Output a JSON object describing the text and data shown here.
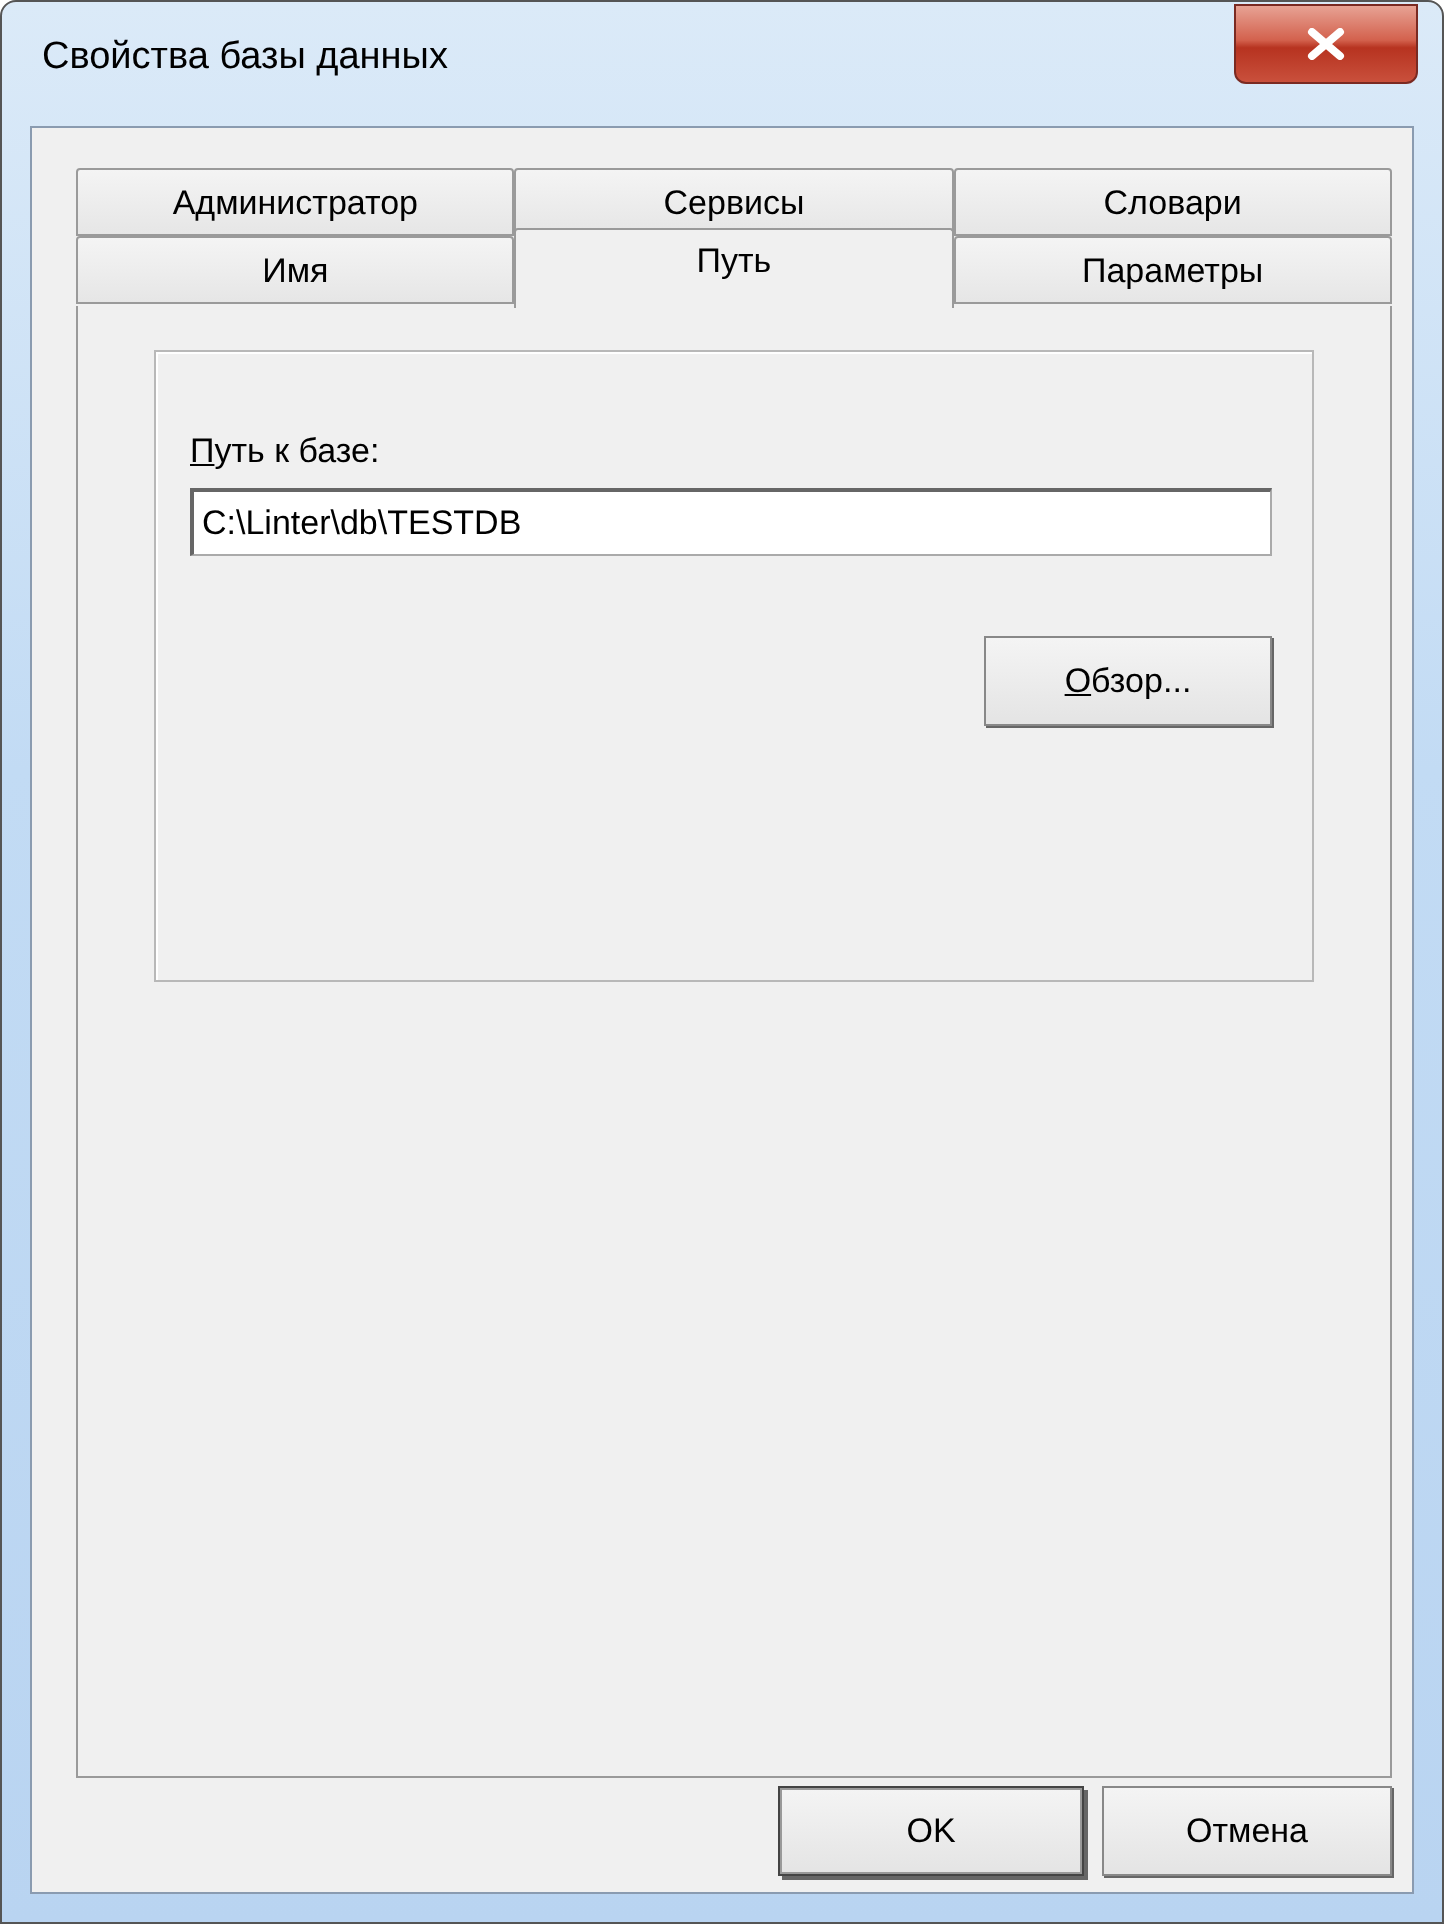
{
  "window": {
    "title": "Свойства базы данных"
  },
  "tab_rows": [
    {
      "tabs": [
        {
          "label": "Администратор",
          "selected": false
        },
        {
          "label": "Сервисы",
          "selected": false
        },
        {
          "label": "Словари",
          "selected": false
        }
      ]
    },
    {
      "tabs": [
        {
          "label": "Имя",
          "selected": false
        },
        {
          "label": "Путь",
          "selected": true
        },
        {
          "label": "Параметры",
          "selected": false
        }
      ]
    }
  ],
  "path_field": {
    "label": "Путь к базе:",
    "access_key_underlined": true,
    "value": "C:\\Linter\\db\\TESTDB"
  },
  "browse_button": {
    "label": "Обзор...",
    "access_key_underlined": true
  },
  "buttons": [
    {
      "label": "OK",
      "default": true
    },
    {
      "label": "Отмена",
      "default": false
    }
  ]
}
